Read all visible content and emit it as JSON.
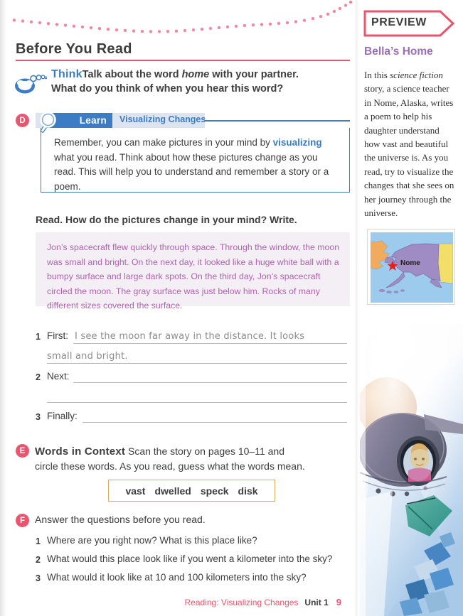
{
  "page": {
    "section_title": "Before You Read",
    "footer": {
      "chapter": "Reading: Visualizing Changes",
      "unit": "Unit 1",
      "page_number": "9"
    }
  },
  "think": {
    "icon": "thought-bubble-icon",
    "label": "Think",
    "line1_a": "Talk about the word ",
    "line1_italic": "home",
    "line1_b": " with your partner.",
    "line2": "What do you think of when you hear this word?"
  },
  "learn": {
    "badge_letter": "D",
    "icon": "magnifying-glass-icon",
    "label": "Learn",
    "topic": "Visualizing Changes",
    "body_a": "Remember, you can make pictures in your mind by ",
    "body_keyword": "visualizing",
    "body_b": " what you read. Think about how these pictures change as you read. This will help you to understand and remember a story or a poem."
  },
  "read": {
    "prompt": "Read. How do the pictures change in your mind? Write.",
    "story": "Jon’s spacecraft flew quickly through space. Through the window, the moon was small and bright. On the next day, it looked like a huge white ball with a bumpy surface and large dark spots. On the third day, Jon’s spacecraft circled the moon. The gray surface was just below him. Rocks of many different sizes covered the surface."
  },
  "answers": [
    {
      "num": "1",
      "label": "First:",
      "handwritten_line1": "I see the moon far away in the distance. It looks",
      "handwritten_line2": "small and bright."
    },
    {
      "num": "2",
      "label": "Next:",
      "handwritten_line1": "",
      "handwritten_line2": ""
    },
    {
      "num": "3",
      "label": "Finally:",
      "handwritten_line1": "",
      "handwritten_line2": ""
    }
  ],
  "words_in_context": {
    "badge_letter": "E",
    "heading": "Words in Context",
    "instruction_line1": " Scan the story on pages 10–11 and",
    "instruction_line2": "circle these words. As you read, guess what the words mean.",
    "words": [
      "vast",
      "dwelled",
      "speck",
      "disk"
    ]
  },
  "questions_section": {
    "badge_letter": "F",
    "heading": "Answer the questions before you read.",
    "items": [
      {
        "num": "1",
        "text": "Where are you right now? What is this place like?"
      },
      {
        "num": "2",
        "text": "What would this place look like if you went a kilometer into the sky?"
      },
      {
        "num": "3",
        "text": "What would it look like at 10 and 100 kilometers into the sky?"
      }
    ]
  },
  "sidebar": {
    "banner_label": "PREVIEW",
    "title": "Bella’s Home",
    "body_a": "In this ",
    "body_italic": "science fiction",
    "body_b": " story, a science teacher in Nome, Alaska, writes a poem to help his daughter understand how vast and beautiful the universe is. As you read, try to visualize the changes that she sees on her journey through the universe.",
    "map": {
      "name": "alaska-map",
      "city_label": "Nome",
      "marker": "red-star-marker",
      "colors": {
        "ocean": "#9dcbee",
        "alaska": "#9f8cc4",
        "russia": "#f0ac5c",
        "canada": "#f2df6a"
      }
    },
    "photo": {
      "name": "spacecraft-illustration",
      "description": "spacecraft porthole with child looking out"
    }
  },
  "colors": {
    "accent_pink": "#e8556f",
    "accent_blue": "#3b7cc4",
    "story_purple": "#b062ae",
    "word_box_border": "#d9ab5c",
    "sidebar_title_purple": "#9b6fb5"
  }
}
